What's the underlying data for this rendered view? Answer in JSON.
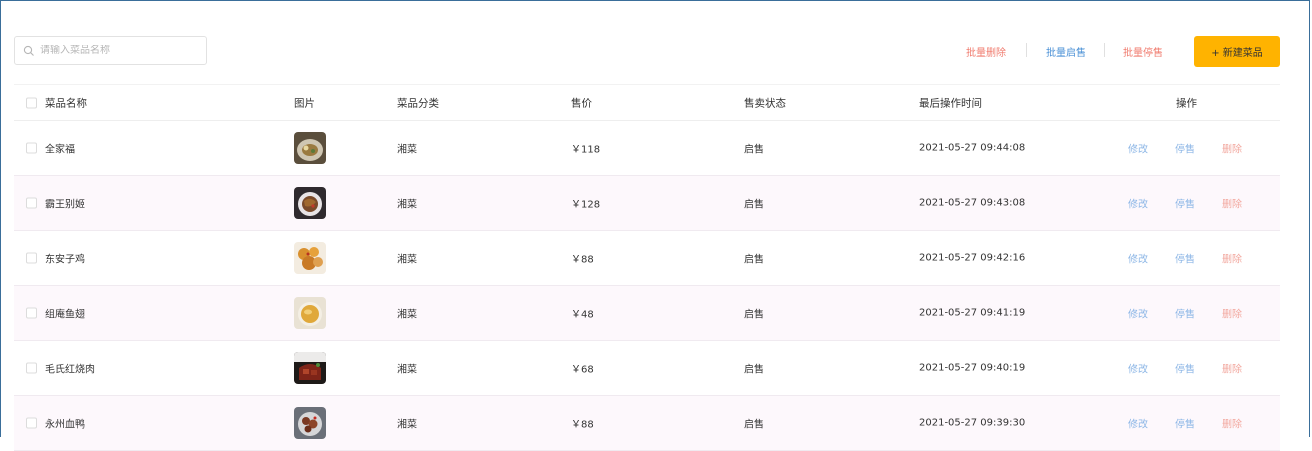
{
  "search": {
    "placeholder": "请输入菜品名称",
    "value": ""
  },
  "toolbar": {
    "batch_delete": "批量删除",
    "batch_enable": "批量启售",
    "batch_disable": "批量停售",
    "new_dish": "+ 新建菜品"
  },
  "table": {
    "headers": {
      "name": "菜品名称",
      "image": "图片",
      "category": "菜品分类",
      "price": "售价",
      "status": "售卖状态",
      "updated": "最后操作时间",
      "actions": "操作"
    },
    "rows": [
      {
        "name": "全家福",
        "category": "湘菜",
        "price": "￥118",
        "status": "启售",
        "updated": "2021-05-27 09:44:08",
        "edit": "修改",
        "toggle": "停售",
        "delete": "删除",
        "image_icon": "dish-photo-icon"
      },
      {
        "name": "霸王别姬",
        "category": "湘菜",
        "price": "￥128",
        "status": "启售",
        "updated": "2021-05-27 09:43:08",
        "edit": "修改",
        "toggle": "停售",
        "delete": "删除",
        "image_icon": "dish-photo-icon"
      },
      {
        "name": "东安子鸡",
        "category": "湘菜",
        "price": "￥88",
        "status": "启售",
        "updated": "2021-05-27 09:42:16",
        "edit": "修改",
        "toggle": "停售",
        "delete": "删除",
        "image_icon": "dish-photo-icon"
      },
      {
        "name": "组庵鱼翅",
        "category": "湘菜",
        "price": "￥48",
        "status": "启售",
        "updated": "2021-05-27 09:41:19",
        "edit": "修改",
        "toggle": "停售",
        "delete": "删除",
        "image_icon": "dish-photo-icon"
      },
      {
        "name": "毛氏红烧肉",
        "category": "湘菜",
        "price": "￥68",
        "status": "启售",
        "updated": "2021-05-27 09:40:19",
        "edit": "修改",
        "toggle": "停售",
        "delete": "删除",
        "image_icon": "dish-photo-icon"
      },
      {
        "name": "永州血鸭",
        "category": "湘菜",
        "price": "￥88",
        "status": "启售",
        "updated": "2021-05-27 09:39:30",
        "edit": "修改",
        "toggle": "停售",
        "delete": "删除",
        "image_icon": "dish-photo-icon"
      }
    ]
  },
  "colors": {
    "primary_button": "#ffb300",
    "link_blue": "#4a90d6",
    "danger_red": "#f07b6e",
    "row_alt": "#fdf8fc"
  }
}
